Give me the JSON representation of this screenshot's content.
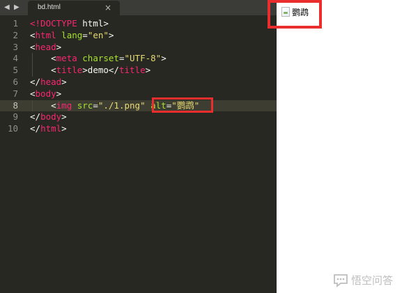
{
  "tab": {
    "title": "bd.html",
    "close": "×"
  },
  "nav": {
    "back": "◀",
    "forward": "▶"
  },
  "code_lines": [
    {
      "num": "1",
      "parts": [
        [
          "t",
          "<!DOCTYPE"
        ],
        [
          "p",
          " html>"
        ]
      ]
    },
    {
      "num": "2",
      "parts": [
        [
          "p",
          "<"
        ],
        [
          "t",
          "html"
        ],
        [
          "p",
          " "
        ],
        [
          "a",
          "lang"
        ],
        [
          "p",
          "="
        ],
        [
          "s",
          "\"en\""
        ],
        [
          "p",
          ">"
        ]
      ]
    },
    {
      "num": "3",
      "parts": [
        [
          "p",
          "<"
        ],
        [
          "t",
          "head"
        ],
        [
          "p",
          ">"
        ]
      ]
    },
    {
      "num": "4",
      "indent": true,
      "parts": [
        [
          "p",
          "    <"
        ],
        [
          "t",
          "meta"
        ],
        [
          "p",
          " "
        ],
        [
          "a",
          "charset"
        ],
        [
          "p",
          "="
        ],
        [
          "s",
          "\"UTF-8\""
        ],
        [
          "p",
          ">"
        ]
      ]
    },
    {
      "num": "5",
      "indent": true,
      "parts": [
        [
          "p",
          "    <"
        ],
        [
          "t",
          "title"
        ],
        [
          "p",
          ">demo</"
        ],
        [
          "t",
          "title"
        ],
        [
          "p",
          ">"
        ]
      ]
    },
    {
      "num": "6",
      "parts": [
        [
          "p",
          "</"
        ],
        [
          "t",
          "head"
        ],
        [
          "p",
          ">"
        ]
      ]
    },
    {
      "num": "7",
      "parts": [
        [
          "p",
          "<"
        ],
        [
          "t",
          "body"
        ],
        [
          "p",
          ">"
        ]
      ]
    },
    {
      "num": "8",
      "active": true,
      "indent": true,
      "parts": [
        [
          "p",
          "    <"
        ],
        [
          "t",
          "img"
        ],
        [
          "p",
          " "
        ],
        [
          "a",
          "src"
        ],
        [
          "p",
          "="
        ],
        [
          "s",
          "\"./1.png\""
        ],
        [
          "p",
          " "
        ],
        [
          "a",
          "alt"
        ],
        [
          "p",
          "="
        ],
        [
          "s",
          "\"鹦鹉\""
        ]
      ]
    },
    {
      "num": "9",
      "parts": [
        [
          "p",
          "</"
        ],
        [
          "t",
          "body"
        ],
        [
          "p",
          ">"
        ]
      ]
    },
    {
      "num": "10",
      "parts": [
        [
          "p",
          "</"
        ],
        [
          "t",
          "html"
        ],
        [
          "p",
          ">"
        ]
      ]
    }
  ],
  "preview": {
    "alt_text": "鹦鹉"
  },
  "watermark": {
    "text": "悟空问答"
  },
  "colors": {
    "highlight_border": "#ea2e2e",
    "editor_bg": "#272822"
  }
}
